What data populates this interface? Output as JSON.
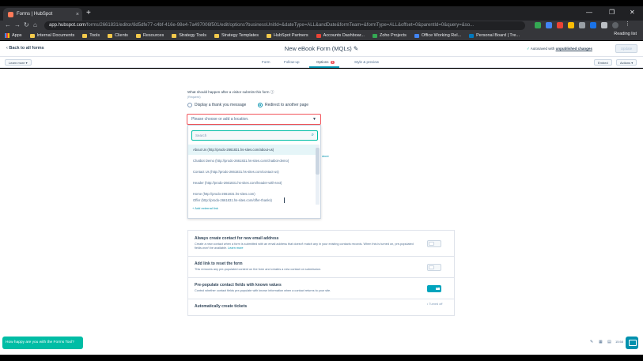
{
  "browser": {
    "tab_title": "Forms | HubSpot",
    "tab_close": "×",
    "new_tab": "+",
    "window_controls": [
      "—",
      "❐",
      "✕"
    ],
    "nav": [
      "←",
      "→",
      "↻",
      "⌂"
    ],
    "url_host": "app.hubspot.com",
    "url_path": "/forms/2661831/editor/8d5dfe77-c4bf-416e-98e4-7a497006f501/edit/options?businessUnitId=&dateType=ALL&andDate&formTeam=&formType=ALL&offset=0&parentId=0&query=&so...",
    "bookmarks": [
      "Apps",
      "Internal Documents",
      "Tools",
      "Clients",
      "Resources",
      "Strategy Tools",
      "Strategy Templates",
      "HubSpot Partners",
      "Accounts Dashboar...",
      "Zoho Projects",
      "Office Working Rel...",
      "Personal Board | Tre..."
    ],
    "reading_list": "Reading list"
  },
  "header": {
    "back_label": "Back to all forms",
    "form_title": "New eBook Form (MQLs)",
    "autosave_prefix": "Autosaved with",
    "autosave_link": "unpublished changes",
    "update_label": "Update"
  },
  "subnav": {
    "learn_more": "Learn more ▾",
    "tabs": [
      "Form",
      "Follow-up",
      "Options",
      "Style & preview"
    ],
    "options_badge": "1",
    "embed_label": "Embed",
    "actions_label": "Actions ▾"
  },
  "options": {
    "question": "What should happen after a visitor submits this form",
    "required": "(Required)",
    "radio_thankyou": "Display a thank you message",
    "radio_redirect": "Redirect to another page",
    "select_placeholder": "Please choose or add a location.",
    "search_placeholder": "Search",
    "locations": [
      "About Us (http://prodo-2661831.hs-sites.com/about-us)",
      "Chatbot Demo (http://prodo-2661831.hs-sites.com/chatbot-demo)",
      "Contact Us (http://prodo-2661831.hs-sites.com/contact-us)",
      "Header (http://prodo-2661831.hs-sites.com/header-with-text)",
      "Home (http://prodo-2661831.hs-sites.com)",
      "Offer (http://prodo-2661831.hs-sites.com/offer-thanks)"
    ],
    "add_external": "+ Add external link",
    "side_fragment": "store"
  },
  "settings": {
    "rows": [
      {
        "title": "Always create contact for new email address",
        "desc": "Create a new contact when a form is submitted with an email address that doesn't match any in your existing contacts records. When this is turned on, pre-populated fields won't be available.",
        "link": "Learn more"
      },
      {
        "title": "Add link to reset the form",
        "desc": "This removes any pre-populated content on the form and creates a new contact on submission."
      },
      {
        "title": "Pre-populate contact fields with known values",
        "desc": "Control whether contact fields pre-populate with known information when a contact returns to your site."
      },
      {
        "title": "Automatically create tickets",
        "value": "Turned off"
      }
    ]
  },
  "feedback_label": "How happy are you with the Forms Tool?",
  "tray": [
    "✎",
    "▦",
    "▤",
    "15:58"
  ]
}
